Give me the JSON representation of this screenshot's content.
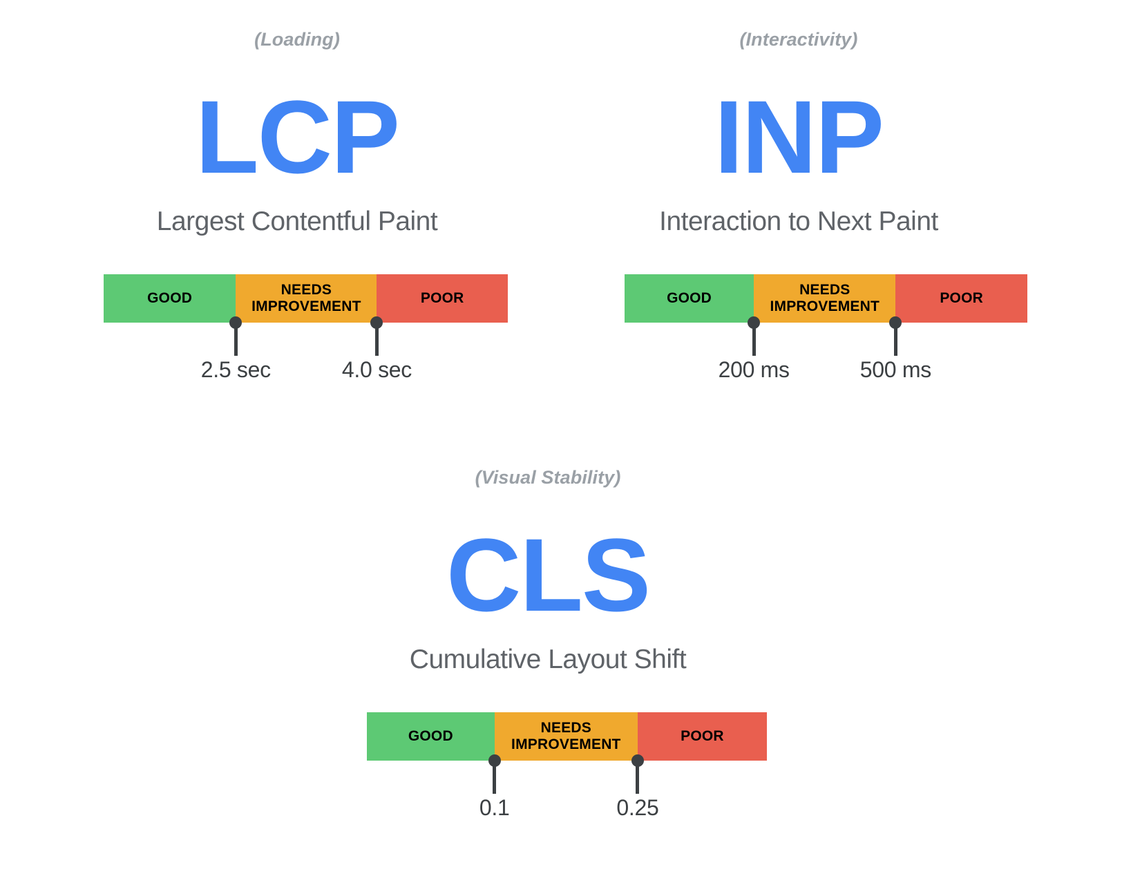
{
  "page": {
    "background": "#ffffff",
    "accent_blue": "#4285f4",
    "text_gray": "#5f6368",
    "muted_gray": "#9aa0a6",
    "marker_dark": "#3c4043"
  },
  "rating_colors": {
    "good": "#5dc974",
    "needs_improvement": "#f0a92e",
    "poor": "#e95f4f"
  },
  "rating_labels": {
    "good": "GOOD",
    "needs_improvement": "NEEDS IMPROVEMENT",
    "poor": "POOR"
  },
  "metrics": [
    {
      "category": "(Loading)",
      "acronym": "LCP",
      "fullname": "Largest Contentful Paint",
      "segments": [
        {
          "rating": "GOOD",
          "label": "GOOD"
        },
        {
          "rating": "NEEDS IMPROVEMENT",
          "label": "NEEDS IMPROVEMENT"
        },
        {
          "rating": "POOR",
          "label": "POOR"
        }
      ],
      "thresholds": [
        {
          "value": "2.5 sec"
        },
        {
          "value": "4.0 sec"
        }
      ]
    },
    {
      "category": "(Interactivity)",
      "acronym": "INP",
      "fullname": "Interaction to Next Paint",
      "segments": [
        {
          "rating": "GOOD",
          "label": "GOOD"
        },
        {
          "rating": "NEEDS IMPROVEMENT",
          "label": "NEEDS IMPROVEMENT"
        },
        {
          "rating": "POOR",
          "label": "POOR"
        }
      ],
      "thresholds": [
        {
          "value": "200 ms"
        },
        {
          "value": "500 ms"
        }
      ]
    },
    {
      "category": "(Visual Stability)",
      "acronym": "CLS",
      "fullname": "Cumulative Layout Shift",
      "segments": [
        {
          "rating": "GOOD",
          "label": "GOOD"
        },
        {
          "rating": "NEEDS IMPROVEMENT",
          "label": "NEEDS IMPROVEMENT"
        },
        {
          "rating": "POOR",
          "label": "POOR"
        }
      ],
      "thresholds": [
        {
          "value": "0.1"
        },
        {
          "value": "0.25"
        }
      ]
    }
  ],
  "chart_data": {
    "type": "bar",
    "title": "Core Web Vitals thresholds",
    "charts": [
      {
        "metric": "LCP",
        "name": "Largest Contentful Paint",
        "category": "Loading",
        "unit": "sec",
        "categories": [
          "GOOD",
          "NEEDS IMPROVEMENT",
          "POOR"
        ],
        "segment_fractions": [
          0.327,
          0.349,
          0.324
        ],
        "boundaries": [
          "2.5 sec",
          "4.0 sec"
        ],
        "boundary_fractions": [
          0.327,
          0.676
        ],
        "colors": [
          "#5dc974",
          "#f0a92e",
          "#e95f4f"
        ]
      },
      {
        "metric": "INP",
        "name": "Interaction to Next Paint",
        "category": "Interactivity",
        "unit": "ms",
        "categories": [
          "GOOD",
          "NEEDS IMPROVEMENT",
          "POOR"
        ],
        "segment_fractions": [
          0.321,
          0.352,
          0.327
        ],
        "boundaries": [
          "200 ms",
          "500 ms"
        ],
        "boundary_fractions": [
          0.321,
          0.673
        ],
        "colors": [
          "#5dc974",
          "#f0a92e",
          "#e95f4f"
        ]
      },
      {
        "metric": "CLS",
        "name": "Cumulative Layout Shift",
        "category": "Visual Stability",
        "unit": "",
        "categories": [
          "GOOD",
          "NEEDS IMPROVEMENT",
          "POOR"
        ],
        "segment_fractions": [
          0.319,
          0.358,
          0.323
        ],
        "boundaries": [
          "0.1",
          "0.25"
        ],
        "boundary_fractions": [
          0.319,
          0.677
        ],
        "colors": [
          "#5dc974",
          "#f0a92e",
          "#e95f4f"
        ]
      }
    ],
    "grid": false,
    "legend": "none"
  }
}
